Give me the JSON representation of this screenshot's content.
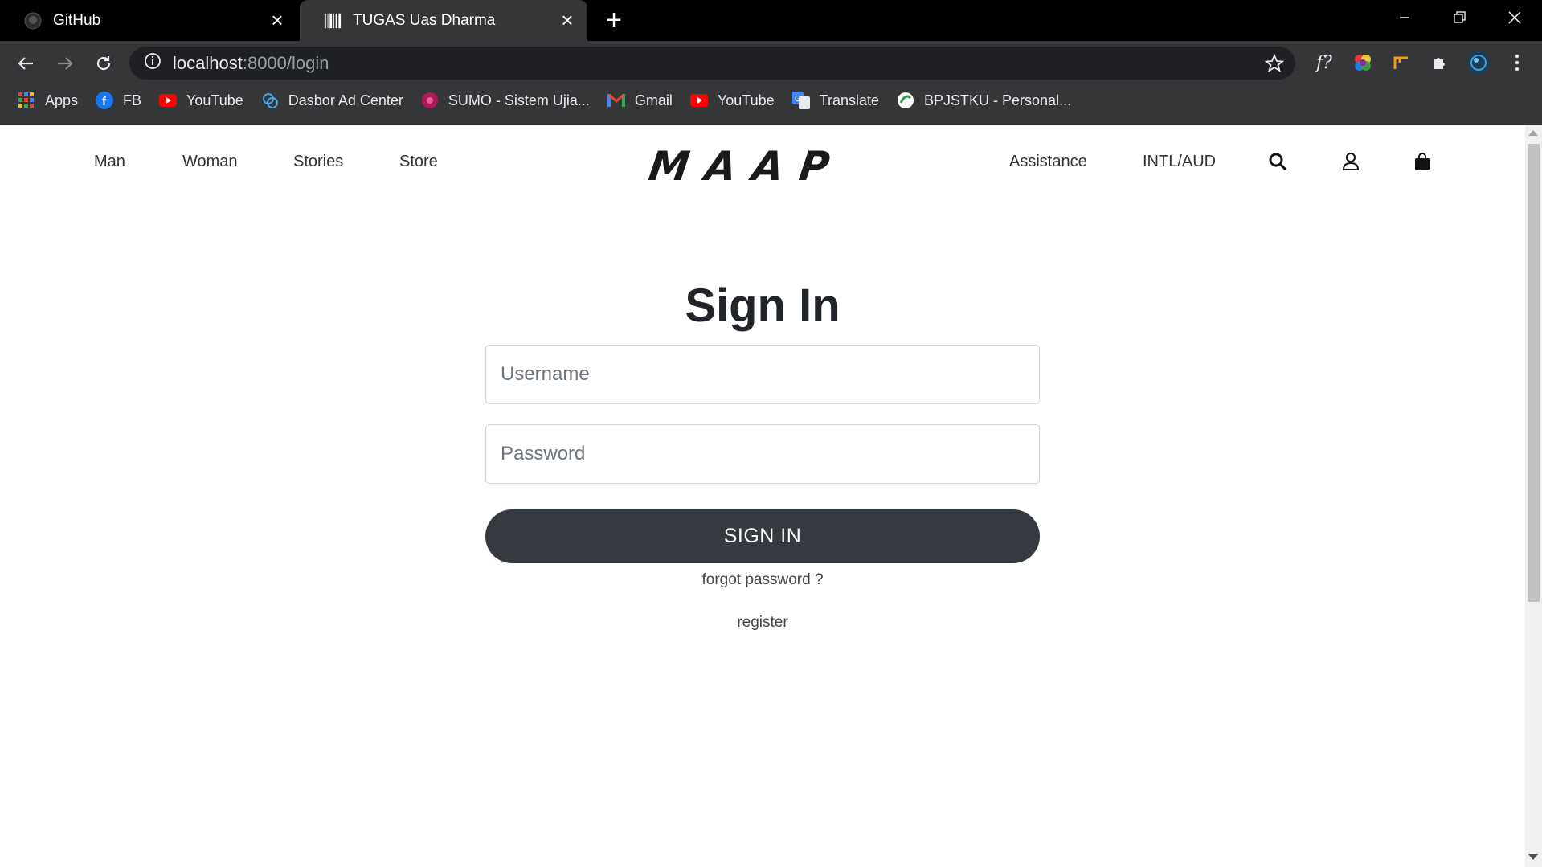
{
  "browser": {
    "tabs": [
      {
        "title": "GitHub",
        "icon": "github-icon",
        "active": false
      },
      {
        "title": "TUGAS Uas Dharma",
        "icon": "barcode-icon",
        "active": true
      }
    ],
    "url_host": "localhost",
    "url_path": ":8000/login",
    "bookmarks": [
      {
        "label": "Apps",
        "icon": "apps-grid-icon"
      },
      {
        "label": "FB",
        "icon": "facebook-icon"
      },
      {
        "label": "YouTube",
        "icon": "youtube-icon"
      },
      {
        "label": "Dasbor Ad Center",
        "icon": "ad-center-icon"
      },
      {
        "label": "SUMO - Sistem Ujia...",
        "icon": "sumo-icon"
      },
      {
        "label": "Gmail",
        "icon": "gmail-icon"
      },
      {
        "label": "YouTube",
        "icon": "youtube-icon"
      },
      {
        "label": "Translate",
        "icon": "translate-icon"
      },
      {
        "label": "BPJSTKU - Personal...",
        "icon": "bpjstku-icon"
      }
    ],
    "extension_label": "f?"
  },
  "site": {
    "nav_left": [
      "Man",
      "Woman",
      "Stories",
      "Store"
    ],
    "logo": "MAAP",
    "nav_right": [
      "Assistance",
      "INTL/AUD"
    ]
  },
  "form": {
    "title": "Sign In",
    "username_placeholder": "Username",
    "password_placeholder": "Password",
    "submit_label": "SIGN IN",
    "forgot_label": "forgot password ?",
    "register_label": "register"
  },
  "colors": {
    "button_bg": "#343a40",
    "chrome_dark": "#353638",
    "tabbar": "#000000"
  }
}
